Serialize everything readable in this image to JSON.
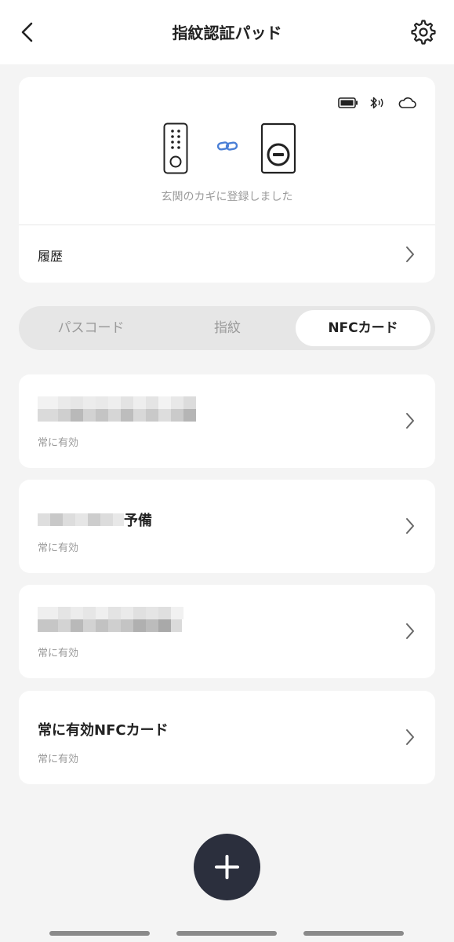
{
  "header": {
    "title": "指紋認証パッド",
    "back_icon": "back-chevron-icon",
    "settings_icon": "gear-icon"
  },
  "device": {
    "status_icons": [
      "battery-icon",
      "bluetooth-icon",
      "cloud-icon"
    ],
    "registered_text": "玄関のカギに登録しました",
    "history_label": "履歴"
  },
  "tabs": [
    {
      "label": "パスコード",
      "active": false
    },
    {
      "label": "指紋",
      "active": false
    },
    {
      "label": "NFCカード",
      "active": true
    }
  ],
  "cards": [
    {
      "name": "",
      "name_redacted": true,
      "status": "常に有効"
    },
    {
      "name_suffix": "予備",
      "name_redacted": true,
      "status": "常に有効"
    },
    {
      "name": "",
      "name_redacted": true,
      "status": "常に有効"
    },
    {
      "name": "常に有効NFCカード",
      "name_redacted": false,
      "status": "常に有効"
    }
  ],
  "add_button": {
    "icon": "plus-icon"
  },
  "colors": {
    "accent_dark": "#2b2f3d",
    "link_blue": "#4a7fd6",
    "muted_text": "#9a9a9a"
  }
}
